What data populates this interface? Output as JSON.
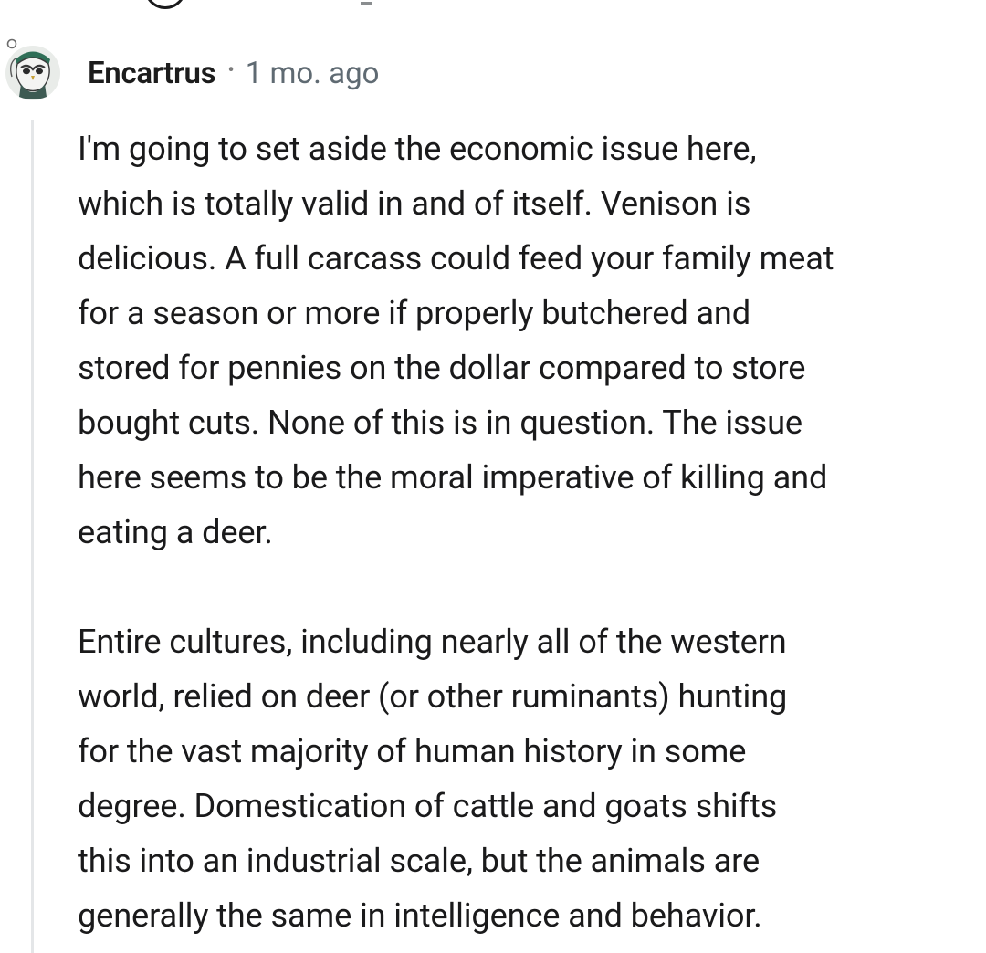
{
  "comment": {
    "author": "Encartrus",
    "separator": "•",
    "timestamp": "1 mo. ago",
    "avatar_icon": "owl-avatar-icon",
    "paragraphs": [
      {
        "lines": [
          "I'm going to set aside the economic issue here,",
          "which is totally valid in and of itself. Venison is",
          "delicious. A full carcass could feed your family meat",
          "for a season or more if properly butchered and",
          "stored for pennies on the dollar compared to store",
          "bought cuts. None of this is in question. The issue",
          "here seems to be the moral imperative of killing and",
          "eating a deer."
        ]
      },
      {
        "lines": [
          "Entire cultures, including nearly all of the western",
          "world, relied on deer (or other ruminants) hunting",
          "for the vast majority of human history in some",
          "degree. Domestication of cattle and goats shifts",
          "this into an industrial scale, but the animals are",
          "generally the same in intelligence and behavior."
        ]
      }
    ]
  },
  "colors": {
    "background": "#ffffff",
    "text": "#1a1a1b",
    "meta": "#5f6a72",
    "thread_line": "#e4e6e8"
  }
}
